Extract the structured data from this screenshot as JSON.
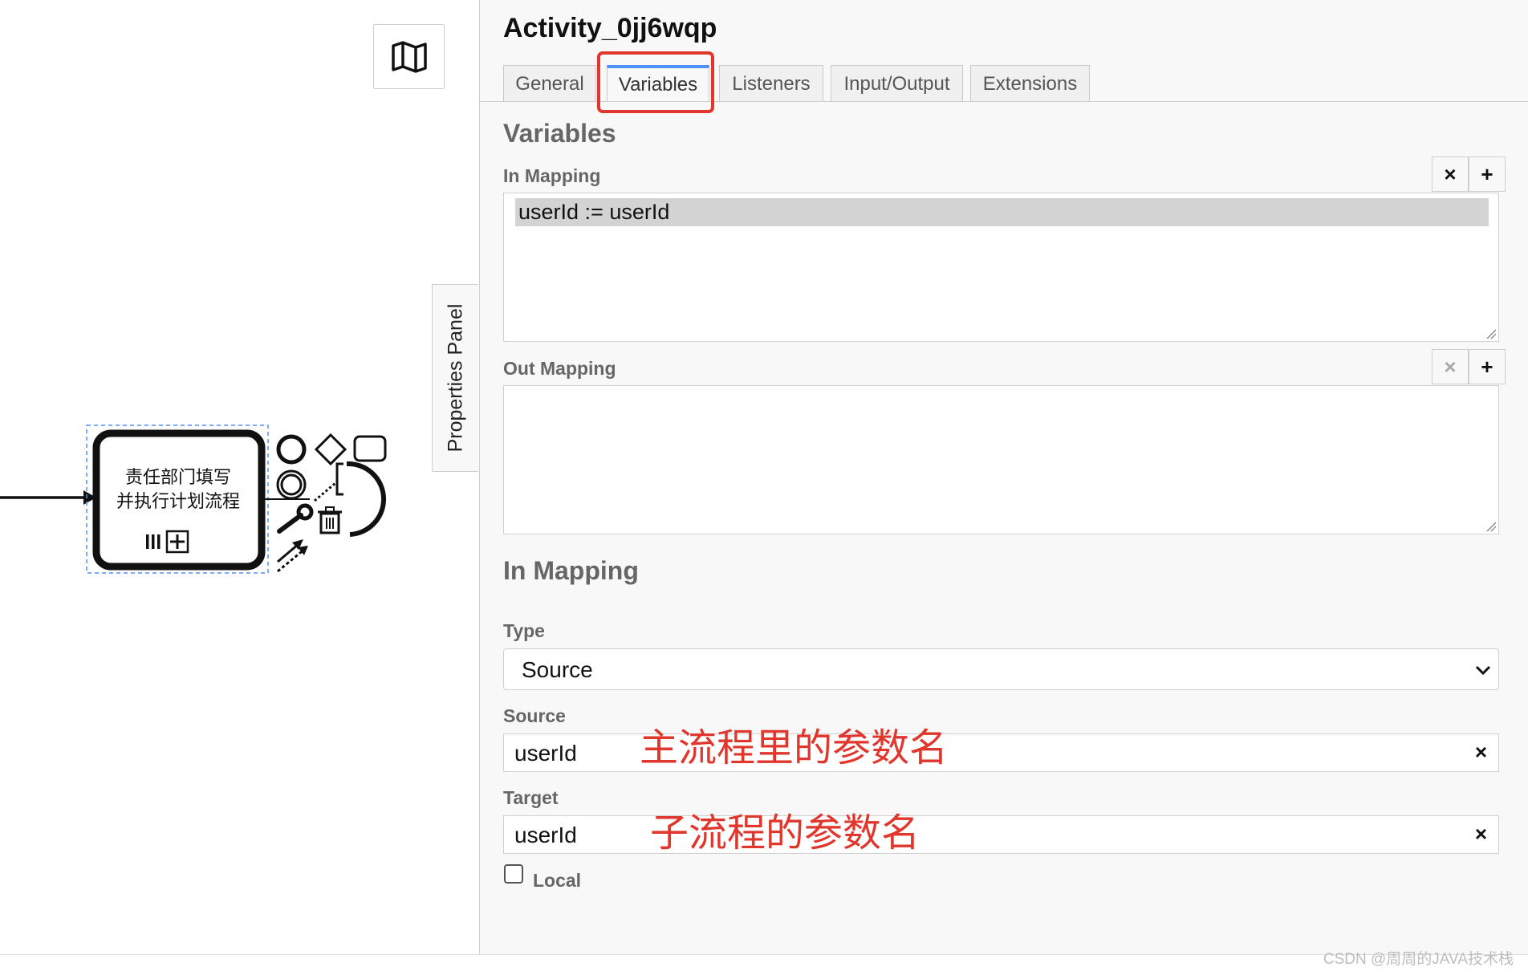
{
  "canvas": {
    "minimap_icon": "map-icon",
    "task_label_line1": "责任部门填写",
    "task_label_line2": "并执行计划流程",
    "properties_toggle_label": "Properties Panel",
    "context_pad_icons": [
      "start-event-icon",
      "gateway-icon",
      "task-icon",
      "intermediate-event-icon",
      "annotation-icon",
      "wrench-icon",
      "trash-icon",
      "connect-arrow-icon"
    ]
  },
  "panel": {
    "title": "Activity_0jj6wqp",
    "tabs": [
      {
        "label": "General",
        "active": false
      },
      {
        "label": "Variables",
        "active": true
      },
      {
        "label": "Listeners",
        "active": false
      },
      {
        "label": "Input/Output",
        "active": false
      },
      {
        "label": "Extensions",
        "active": false
      }
    ],
    "section_title": "Variables",
    "in_mapping": {
      "label": "In Mapping",
      "remove_label": "×",
      "add_label": "+",
      "items": [
        "userId := userId"
      ]
    },
    "out_mapping": {
      "label": "Out Mapping",
      "remove_label": "×",
      "add_label": "+",
      "items": []
    },
    "detail": {
      "title": "In Mapping",
      "type_label": "Type",
      "type_value": "Source",
      "source_label": "Source",
      "source_value": "userId",
      "source_clear": "×",
      "target_label": "Target",
      "target_value": "userId",
      "target_clear": "×",
      "local_label": "Local",
      "local_checked": false
    }
  },
  "annotations": {
    "source_note": "主流程里的参数名",
    "target_note": "子流程的参数名"
  },
  "watermark": "CSDN @周周的JAVA技术栈",
  "colors": {
    "highlight": "#e0362c",
    "active_tab": "#4d90fe",
    "selection": "#d3d3d3",
    "dashed_selection": "#4d90fe"
  }
}
